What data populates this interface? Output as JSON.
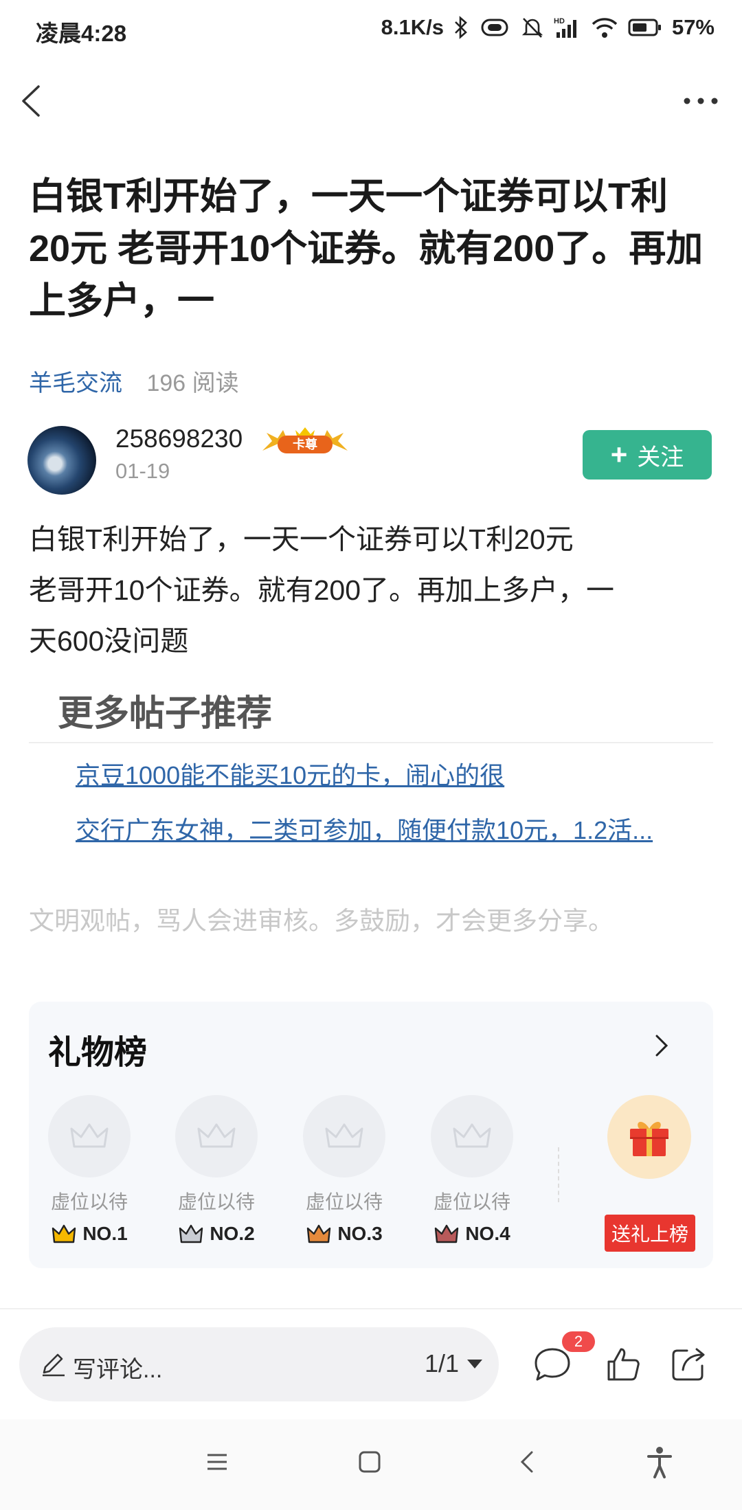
{
  "status_bar": {
    "time": "凌晨4:28",
    "network_speed": "8.1K/s",
    "battery": "57%"
  },
  "post": {
    "title": "白银T利开始了，一天一个证券可以T利20元 老哥开10个证券。就有200了。再加上多户，一",
    "category": "羊毛交流",
    "reads": "196 阅读",
    "author": {
      "name": "258698230",
      "badge": "卡尊",
      "date": "01-19"
    },
    "follow_label": "关注",
    "body_lines": [
      "白银T利开始了，一天一个证券可以T利20元",
      "老哥开10个证券。就有200了。再加上多户，一",
      "天600没问题"
    ]
  },
  "recommend": {
    "title": "更多帖子推荐",
    "links": [
      "京豆1000能不能买10元的卡，闹心的很",
      "交行广东女神，二类可参加，随便付款10元，1.2活..."
    ]
  },
  "notice": "文明观帖，骂人会进审核。多鼓励，才会更多分享。",
  "gift": {
    "title": "礼物榜",
    "slots": [
      {
        "label": "虚位以待",
        "rank": "NO.1",
        "crown_color": "#f5b800"
      },
      {
        "label": "虚位以待",
        "rank": "NO.2",
        "crown_color": "#c9ccd3"
      },
      {
        "label": "虚位以待",
        "rank": "NO.3",
        "crown_color": "#e58a3c"
      },
      {
        "label": "虚位以待",
        "rank": "NO.4",
        "crown_color": "#b85a5a"
      }
    ],
    "send_label": "送礼上榜"
  },
  "comment_bar": {
    "placeholder": "写评论...",
    "pager": "1/1",
    "comment_count": "2"
  },
  "colors": {
    "accent_green": "#36b48f",
    "link_blue": "#2f66a8",
    "red": "#e8362f"
  }
}
